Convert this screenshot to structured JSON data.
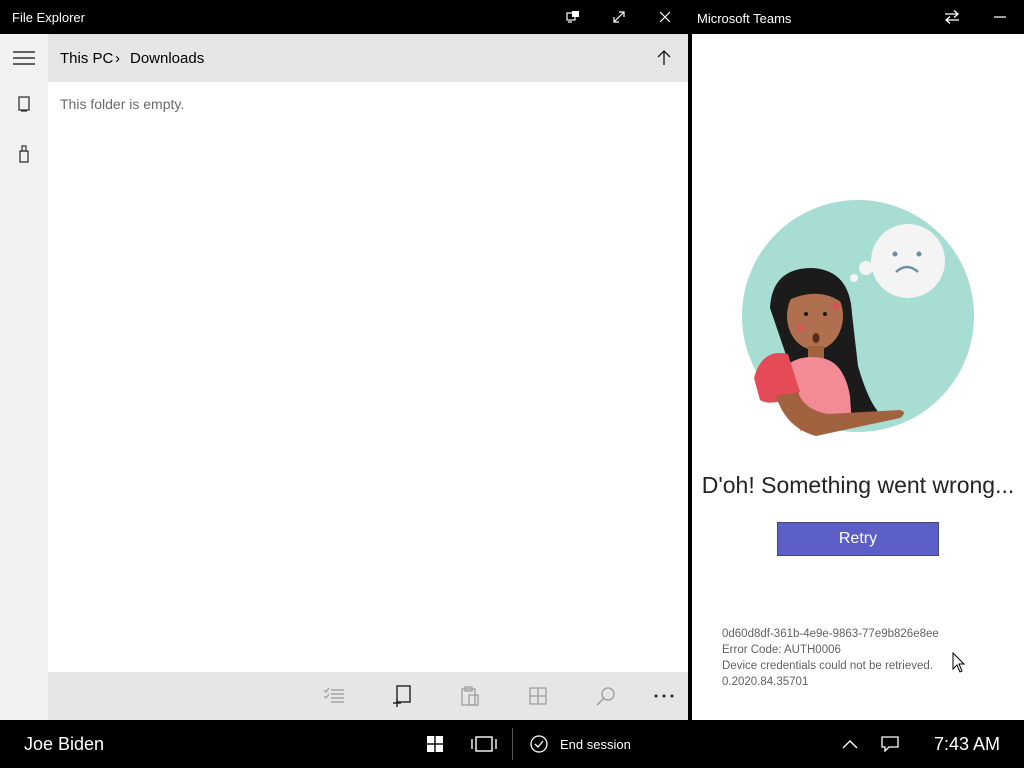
{
  "file_explorer": {
    "title": "File Explorer",
    "breadcrumb": {
      "root": "This PC",
      "separator": "›",
      "current": "Downloads"
    },
    "empty_message": "This folder is empty."
  },
  "teams": {
    "title": "Microsoft Teams",
    "headline": "D'oh! Something went wrong...",
    "retry_label": "Retry",
    "details": {
      "session_id": "0d60d8df-361b-4e9e-9863-77e9b826e8ee",
      "error_code": "Error Code: AUTH0006",
      "message": "Device credentials could not be retrieved.",
      "version": "0.2020.84.35701"
    }
  },
  "taskbar": {
    "user_name": "Joe Biden",
    "end_session_label": "End session",
    "time": "7:43 AM"
  },
  "colors": {
    "retry_button": "#5b5fc7",
    "illustration_bg": "#a8ddd3"
  }
}
